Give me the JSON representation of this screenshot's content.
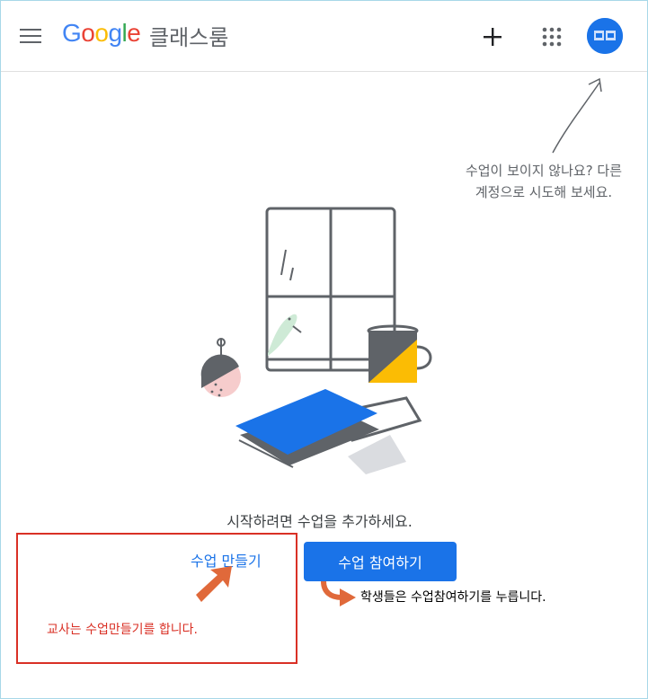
{
  "header": {
    "logo": "Google",
    "app_name": "클래스룸"
  },
  "icons": {
    "menu": "hamburger-menu-icon",
    "add": "plus-icon",
    "apps": "google-apps-icon",
    "account": "account-avatar"
  },
  "hint": {
    "line1": "수업이 보이지 않나요? 다른",
    "line2": "계정으로 시도해 보세요."
  },
  "main": {
    "prompt": "시작하려면 수업을 추가하세요.",
    "create_label": "수업 만들기",
    "join_label": "수업 참여하기"
  },
  "annotations": {
    "teacher_note": "교사는 수업만들기를 합니다.",
    "student_note": "학생들은 수업참여하기를 누릅니다."
  },
  "colors": {
    "accent": "#1a73e8",
    "annotation_red": "#d93025",
    "annotation_orange": "#e0693a",
    "mug_yellow": "#fbbc04",
    "book_blue": "#1a73e8",
    "bird_green": "#ceead6",
    "ornament_pink": "#f6cccc"
  }
}
